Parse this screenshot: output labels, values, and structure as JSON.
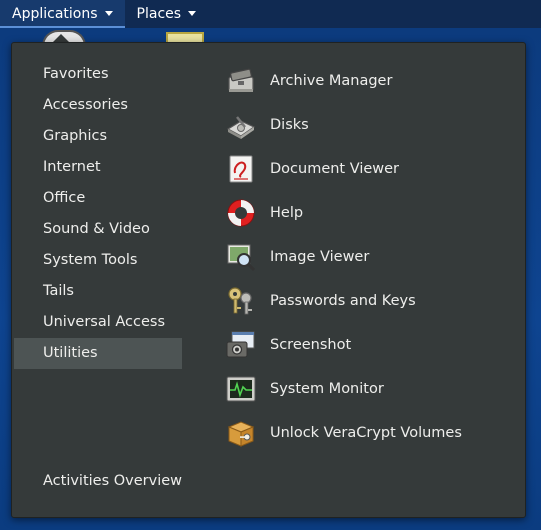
{
  "topbar": {
    "applications_label": "Applications",
    "places_label": "Places"
  },
  "menu": {
    "categories": [
      {
        "label": "Favorites"
      },
      {
        "label": "Accessories"
      },
      {
        "label": "Graphics"
      },
      {
        "label": "Internet"
      },
      {
        "label": "Office"
      },
      {
        "label": "Sound & Video"
      },
      {
        "label": "System Tools"
      },
      {
        "label": "Tails"
      },
      {
        "label": "Universal Access"
      },
      {
        "label": "Utilities"
      }
    ],
    "selected_category": "Utilities",
    "activities_label": "Activities Overview",
    "apps": [
      {
        "label": "Archive Manager",
        "icon": "archive-manager-icon"
      },
      {
        "label": "Disks",
        "icon": "disks-icon"
      },
      {
        "label": "Document Viewer",
        "icon": "document-viewer-icon"
      },
      {
        "label": "Help",
        "icon": "help-lifebuoy-icon"
      },
      {
        "label": "Image Viewer",
        "icon": "image-viewer-icon"
      },
      {
        "label": "Passwords and Keys",
        "icon": "keys-icon"
      },
      {
        "label": "Screenshot",
        "icon": "camera-icon"
      },
      {
        "label": "System Monitor",
        "icon": "system-monitor-icon"
      },
      {
        "label": "Unlock VeraCrypt Volumes",
        "icon": "veracrypt-box-icon"
      }
    ]
  },
  "colors": {
    "desktop": "#0d3f86",
    "topbar": "#102a52",
    "menu_bg": "#353a3a",
    "selected_bg": "#4d5454",
    "text": "#eeeeec"
  }
}
